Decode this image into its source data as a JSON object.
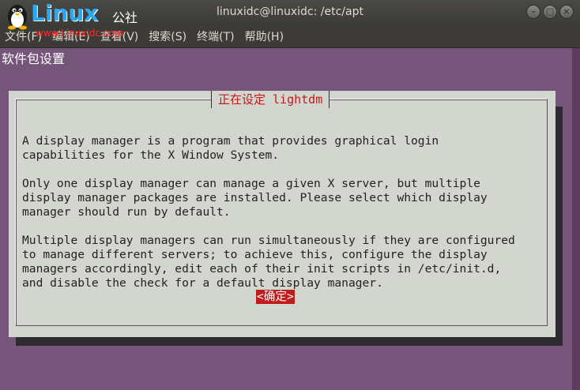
{
  "window": {
    "title": "linuxidc@linuxidc: /etc/apt",
    "buttons": {
      "minimize": "–",
      "maximize": "□",
      "close": "×"
    }
  },
  "watermark": {
    "brand": "Linux",
    "brand_sub": "公社",
    "url": "www.Linuxidc.com"
  },
  "menubar": {
    "items": [
      {
        "label": "文件(F)"
      },
      {
        "label": "编辑(E)"
      },
      {
        "label": "查看(V)"
      },
      {
        "label": "搜索(S)"
      },
      {
        "label": "终端(T)"
      },
      {
        "label": "帮助(H)"
      }
    ]
  },
  "terminal": {
    "header": "软件包设置",
    "background": "#76557a",
    "dialog": {
      "title": "正在设定 lightdm",
      "paragraphs": [
        "A display manager is a program that provides graphical login\ncapabilities for the X Window System.",
        "Only one display manager can manage a given X server, but multiple\ndisplay manager packages are installed. Please select which display\nmanager should run by default.",
        "Multiple display managers can run simultaneously if they are configured\nto manage different servers; to achieve this, configure the display\nmanagers accordingly, edit each of their init scripts in /etc/init.d,\nand disable the check for a default display manager."
      ],
      "ok_label": "<确定>"
    }
  },
  "colors": {
    "accent_red": "#c01c1c",
    "dialog_bg": "#d3d5cf",
    "chrome": "#3c3b37"
  }
}
